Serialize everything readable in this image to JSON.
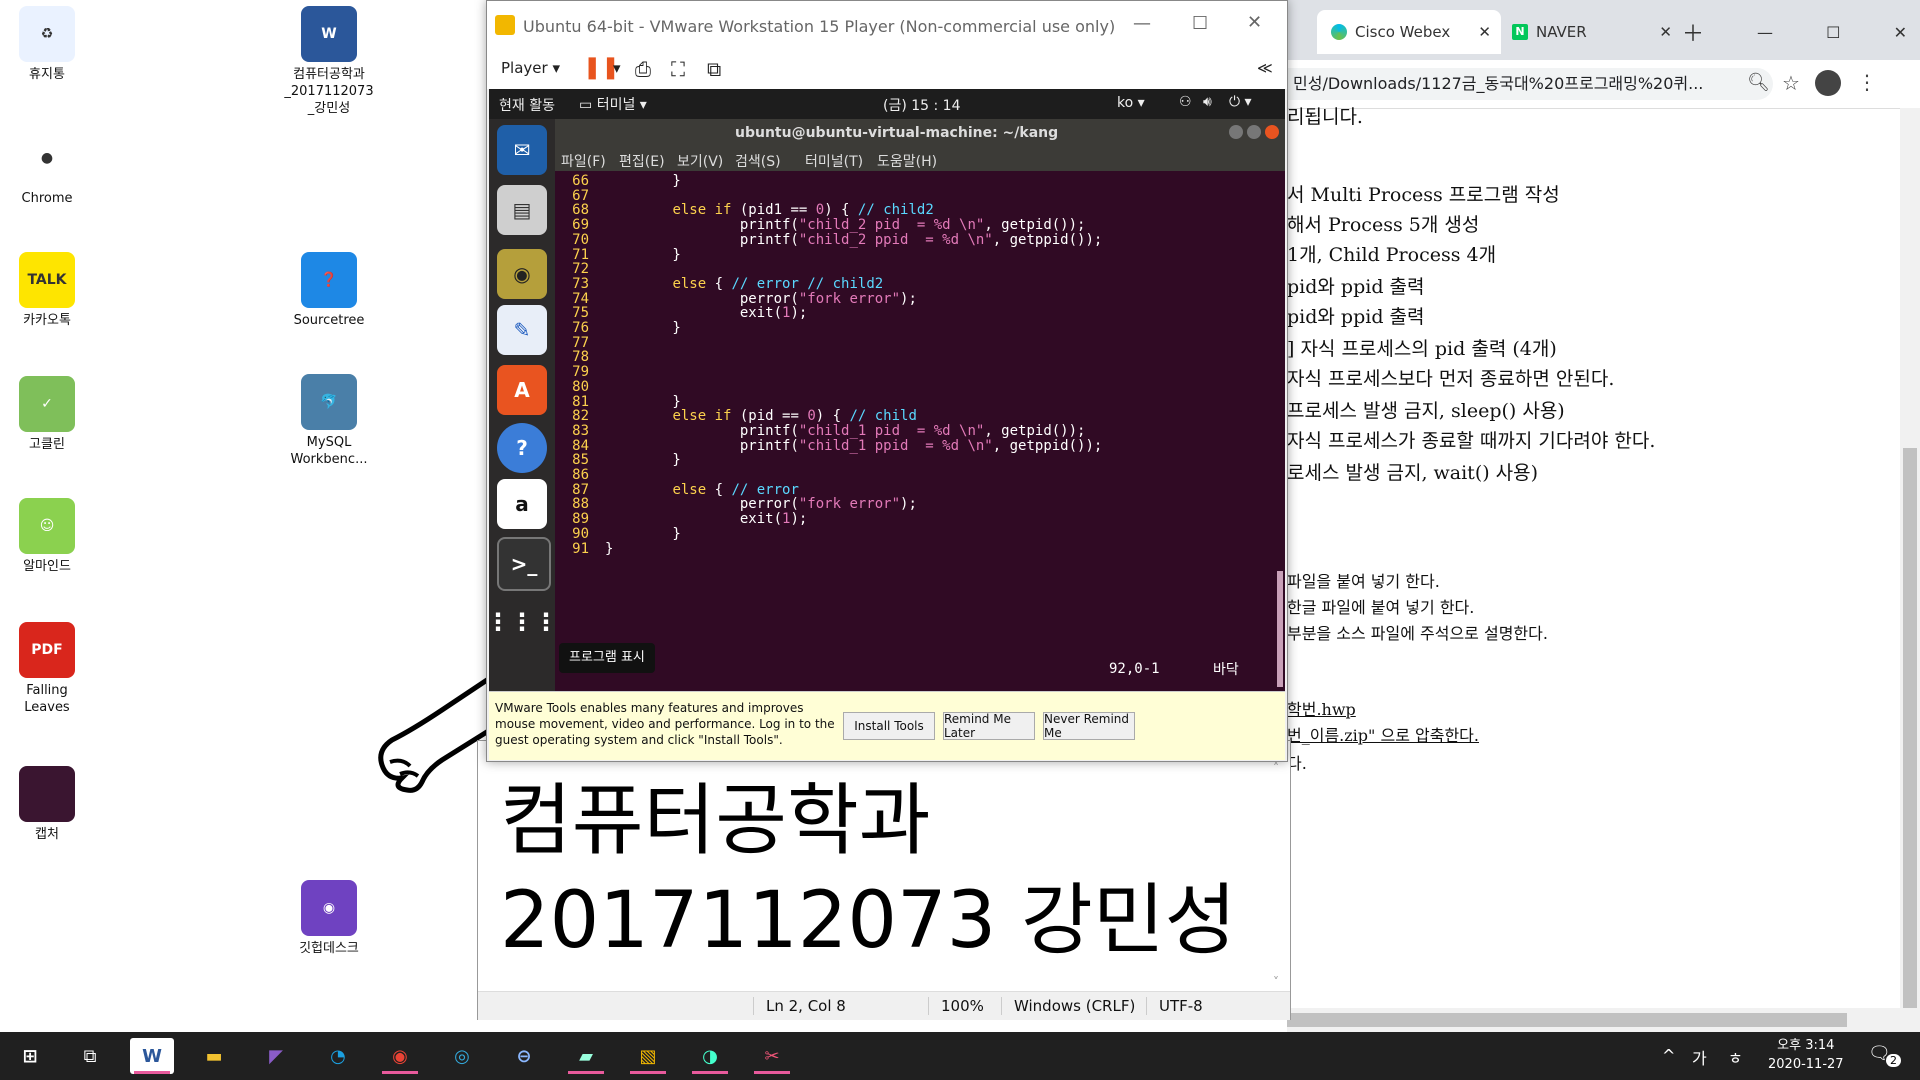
{
  "desktop": {
    "icons": [
      {
        "label": "휴지통",
        "glyph": "♻",
        "bg": "#eaf2ff"
      },
      {
        "label": "Chrome",
        "glyph": "●",
        "bg": "#ffffff"
      },
      {
        "label": "카카오톡",
        "glyph": "TALK",
        "bg": "#fee500"
      },
      {
        "label": "고클린",
        "glyph": "✓",
        "bg": "#7fbf5a"
      },
      {
        "label": "알마인드",
        "glyph": "☺",
        "bg": "#8bd14f"
      },
      {
        "label": "Falling\nLeaves",
        "glyph": "PDF",
        "bg": "#d9261c"
      },
      {
        "label": "캡처",
        "glyph": "",
        "bg": "#3a1530"
      }
    ],
    "icons2": [
      {
        "label": "컴퓨터공학과\n_2017112073\n_강민성",
        "glyph": "W",
        "bg": "#2b579a"
      },
      {
        "label": "Sourcetree",
        "glyph": "❓",
        "bg": "#1e88e5"
      },
      {
        "label": "MySQL\nWorkbenc...",
        "glyph": "🐬",
        "bg": "#4a7fa8"
      },
      {
        "label": "깃헙데스크",
        "glyph": "◉",
        "bg": "#6f42c1"
      }
    ]
  },
  "chrome": {
    "tabs": [
      {
        "label": "Cisco Webex",
        "icon": "webex-icon"
      },
      {
        "label": "NAVER",
        "icon": "naver-icon"
      }
    ],
    "address": "민성/Downloads/1127금_동국대%20프로그래밍%20퀴...",
    "lines": [
      "리됩니다.",
      "",
      "서 Multi Process 프로그램 작성",
      "해서 Process 5개 생성",
      "1개, Child Process 4개",
      "pid와 ppid 출력",
      "pid와 ppid 출력",
      "] 자식 프로세스의 pid 출력 (4개)",
      "자식 프로세스보다 먼저 종료하면 안된다.",
      "프로세스 발생 금지, sleep() 사용)",
      "자식 프로세스가 종료할 때까지 기다려야 한다.",
      "로세스 발생 금지, wait() 사용)"
    ],
    "lines2": [
      "파일을 붙여 넣기 한다.",
      " 한글 파일에 붙여 넣기 한다.",
      "부분을 소스 파일에 주석으로 설명한다."
    ],
    "lines3": [
      "학번.hwp",
      "번_이름.zip\" 으로 압축한다.",
      "다."
    ]
  },
  "vmware": {
    "title": "Ubuntu 64-bit - VMware Workstation 15 Player (Non-commercial use only)",
    "player_menu": "Player",
    "gnome": {
      "activities": "현재 활동",
      "app": "터미널",
      "clock": "(금) 15 : 14",
      "lang": "ko"
    },
    "terminal": {
      "title": "ubuntu@ubuntu-virtual-machine: ~/kang",
      "menu": [
        "파일(F)",
        "편집(E)",
        "보기(V)",
        "검색(S)",
        "터미널(T)",
        "도움말(H)"
      ],
      "status_pos": "92,0-1",
      "status_loc": "바닥",
      "tooltip": "프로그램 표시"
    },
    "notice": {
      "text": "VMware Tools enables many features and improves mouse movement, video and performance. Log in to the guest operating system and click \"Install Tools\".",
      "install": "Install Tools",
      "remind": "Remind Me Later",
      "never": "Never Remind Me"
    }
  },
  "code_lines": [
    {
      "n": "66",
      "code": "        }"
    },
    {
      "n": "67",
      "code": ""
    },
    {
      "n": "68",
      "code": "        else if (pid1 == 0) { // child2"
    },
    {
      "n": "69",
      "code": "                printf(\"child_2 pid  = %d \\n\", getpid());"
    },
    {
      "n": "70",
      "code": "                printf(\"child_2 ppid  = %d \\n\", getppid());"
    },
    {
      "n": "71",
      "code": "        }"
    },
    {
      "n": "72",
      "code": ""
    },
    {
      "n": "73",
      "code": "        else { // error // child2"
    },
    {
      "n": "74",
      "code": "                perror(\"fork error\");"
    },
    {
      "n": "75",
      "code": "                exit(1);"
    },
    {
      "n": "76",
      "code": "        }"
    },
    {
      "n": "77",
      "code": ""
    },
    {
      "n": "78",
      "code": ""
    },
    {
      "n": "79",
      "code": ""
    },
    {
      "n": "80",
      "code": ""
    },
    {
      "n": "81",
      "code": "        }"
    },
    {
      "n": "82",
      "code": "        else if (pid == 0) { // child"
    },
    {
      "n": "83",
      "code": "                printf(\"child_1 pid  = %d \\n\", getpid());"
    },
    {
      "n": "84",
      "code": "                printf(\"child_1 ppid  = %d \\n\", getppid());"
    },
    {
      "n": "85",
      "code": "        }"
    },
    {
      "n": "86",
      "code": ""
    },
    {
      "n": "87",
      "code": "        else { // error"
    },
    {
      "n": "88",
      "code": "                perror(\"fork error\");"
    },
    {
      "n": "89",
      "code": "                exit(1);"
    },
    {
      "n": "90",
      "code": "        }"
    },
    {
      "n": "91",
      "code": "}"
    }
  ],
  "notepad": {
    "line1": "컴퓨터공학과",
    "line2": "2017112073 강민성",
    "status": {
      "pos": "Ln 2, Col 8",
      "zoom": "100%",
      "eol": "Windows (CRLF)",
      "enc": "UTF-8"
    }
  },
  "taskbar": {
    "ime1": "가",
    "ime2": "ㅎ",
    "time": "오후 3:14",
    "date": "2020-11-27",
    "notif_count": "2"
  }
}
